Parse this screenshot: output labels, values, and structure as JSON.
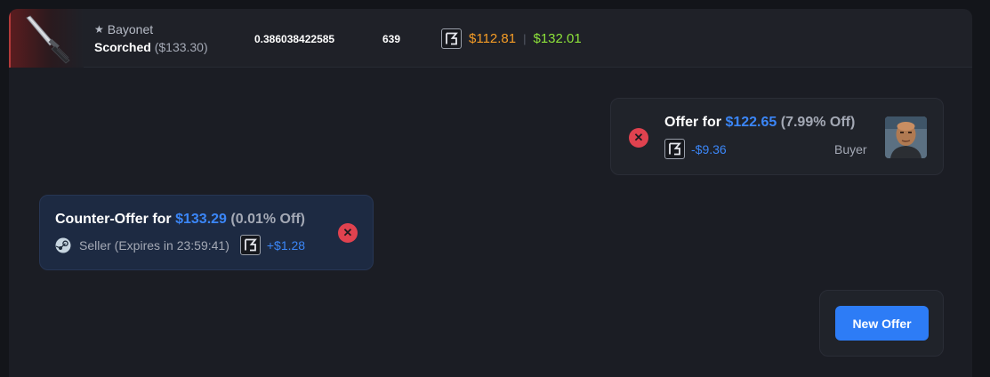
{
  "item": {
    "icon": "bayonet-knife-image",
    "name": "Bayonet",
    "star": "★",
    "wear": "Scorched",
    "reference_price": "($133.30)",
    "float": "0.386038422585",
    "pattern": "639",
    "market_icon": "marketplace-logo-icon",
    "price_low": "$112.81",
    "price_sep": "|",
    "price_high": "$132.01"
  },
  "offer": {
    "title_prefix": "Offer for",
    "amount": "$122.65",
    "discount": "(7.99% Off)",
    "diff": "-$9.36",
    "role": "Buyer",
    "avatar": "buyer-avatar-photo"
  },
  "counter_offer": {
    "title_prefix": "Counter-Offer for",
    "amount": "$133.29",
    "discount": "(0.01% Off)",
    "seller_label": "Seller (Expires in 23:59:41)",
    "diff": "+$1.28"
  },
  "actions": {
    "new_offer_label": "New Offer"
  },
  "colors": {
    "background": "#13151a",
    "panel": "#1b1d24",
    "accent_blue": "#3b86f7",
    "price_orange": "#f59c26",
    "price_green": "#8de23a",
    "reject_red": "#e0424f",
    "button_blue": "#2d7cf6"
  }
}
